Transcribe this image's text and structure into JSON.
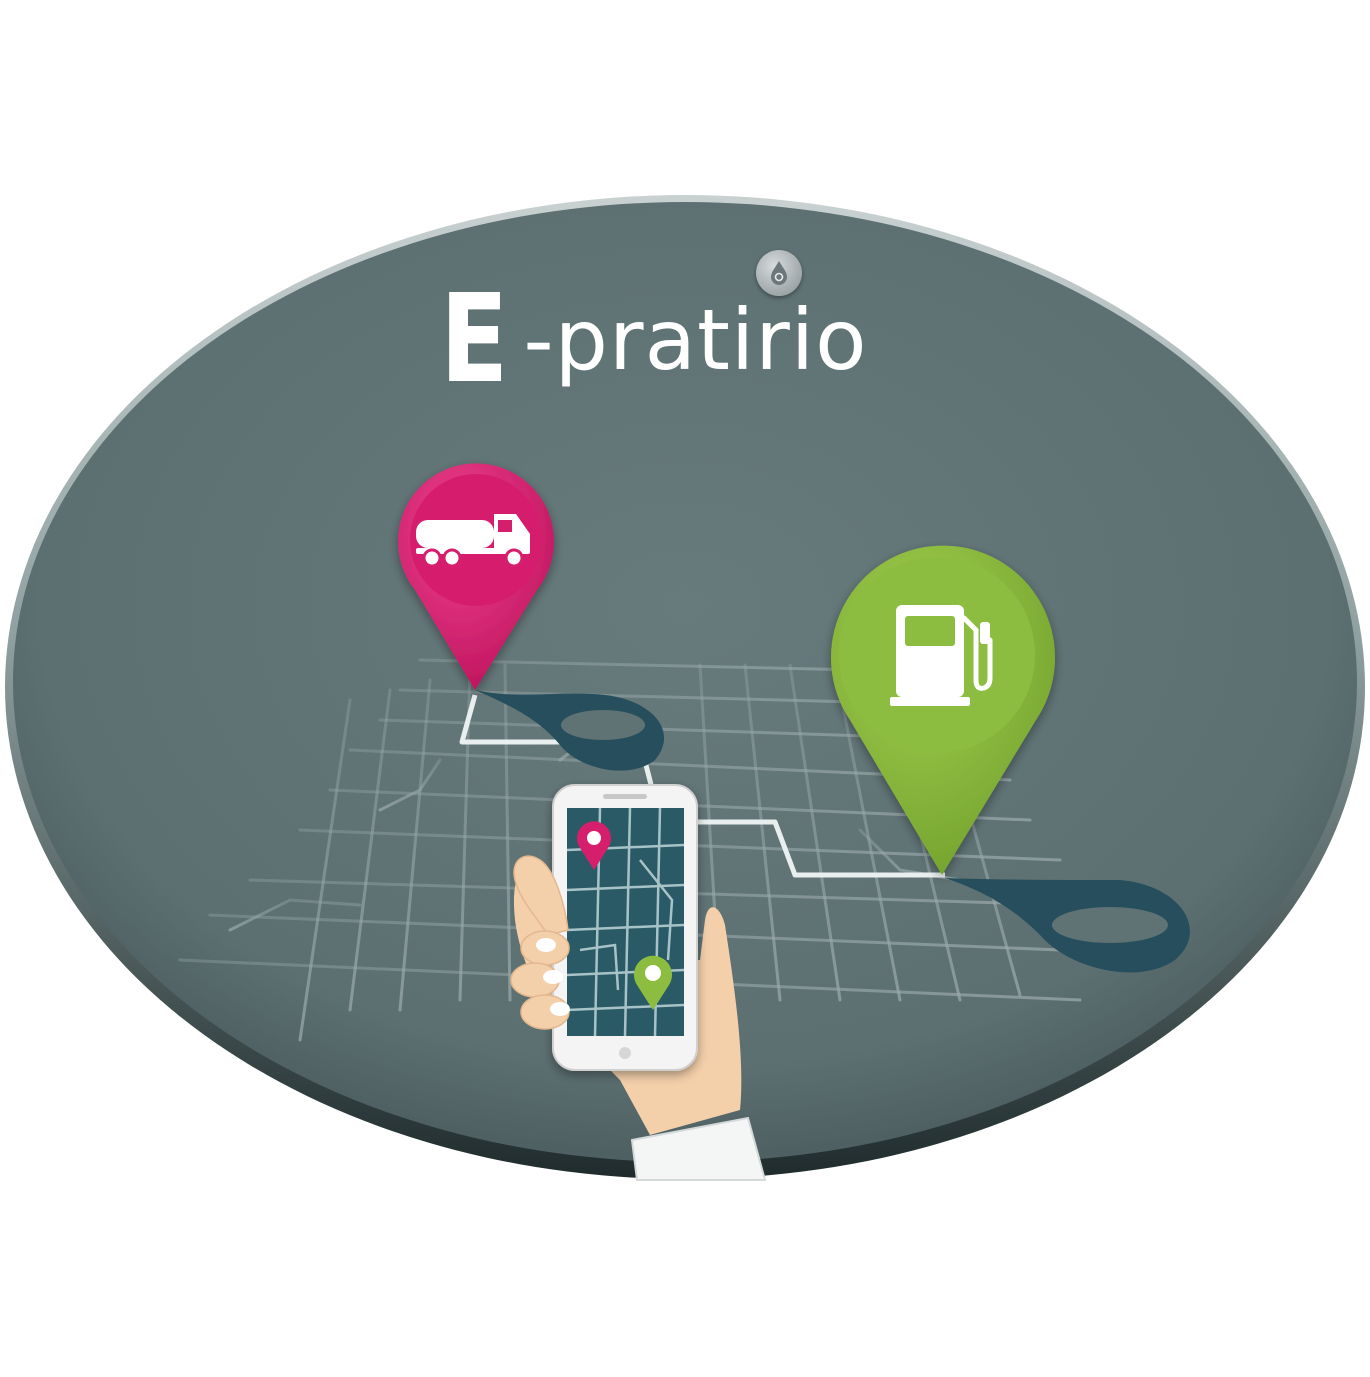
{
  "brand": {
    "initial": "E",
    "rest": "-pratirio"
  },
  "icons": {
    "logo_badge": "fuel-drop-gear-icon",
    "pin_left": "tanker-truck-icon",
    "pin_right": "fuel-pump-icon",
    "phone_pins": [
      "map-pin-pink-icon",
      "map-pin-green-icon"
    ]
  },
  "colors": {
    "oval": "#5f7274",
    "oval_rim": "#a9b4b4",
    "pin_pink": "#d81b6a",
    "pin_green": "#8ab93d",
    "route_shadow": "#264e5c",
    "phone_screen": "#2b5a66",
    "streets": "#8a9a9c",
    "skin": "#f3cfaa"
  }
}
